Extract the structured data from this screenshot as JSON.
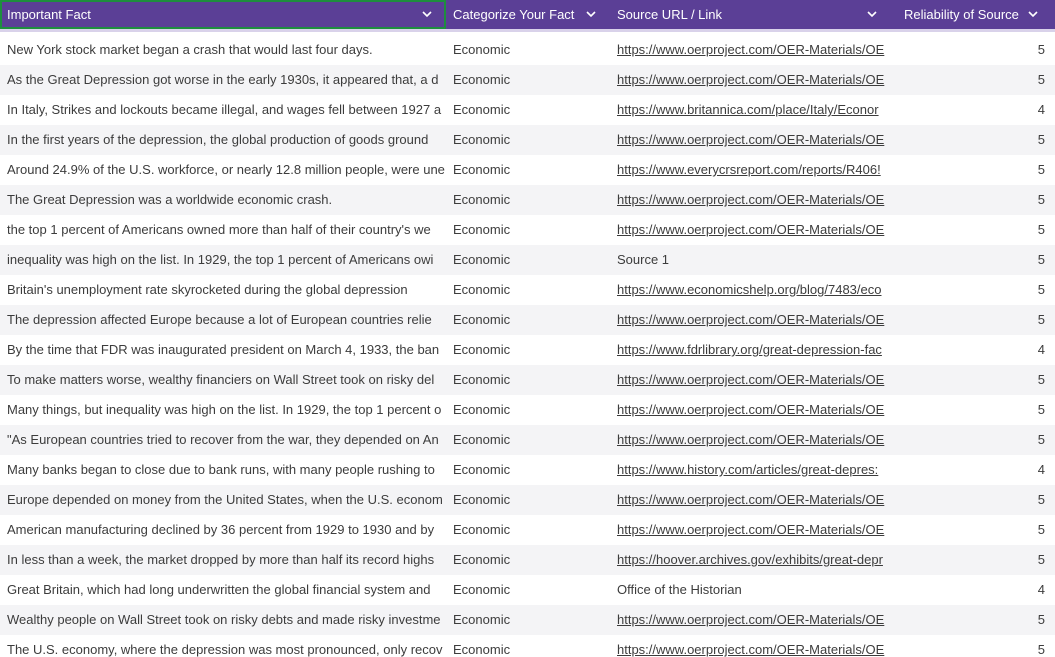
{
  "header": {
    "columns": [
      {
        "label": "Important Fact",
        "icon": "chevron-down-icon"
      },
      {
        "label": "Categorize Your Fact",
        "icon": "chevron-down-icon"
      },
      {
        "label": "Source URL / Link",
        "icon": "chevron-down-icon"
      },
      {
        "label": "Reliability of Source",
        "icon": "chevron-down-icon"
      }
    ]
  },
  "colors": {
    "header_bg": "#5b3f96",
    "active_border": "#1e8e3e"
  },
  "rows": [
    {
      "fact": "New York stock market began a crash that would last four days.",
      "category": "Economic",
      "source": "https://www.oerproject.com/OER-Materials/OE",
      "is_link": true,
      "reliability": "5"
    },
    {
      "fact": "As the Great Depression got worse in the early 1930s, it appeared that, a d",
      "category": "Economic",
      "source": "https://www.oerproject.com/OER-Materials/OE",
      "is_link": true,
      "reliability": "5"
    },
    {
      "fact": "In Italy, Strikes and lockouts became illegal, and wages fell between 1927 a",
      "category": "Economic",
      "source": "https://www.britannica.com/place/Italy/Econor",
      "is_link": true,
      "reliability": "4"
    },
    {
      "fact": "In the first years of the depression, the global production of goods ground",
      "category": "Economic",
      "source": "https://www.oerproject.com/OER-Materials/OE",
      "is_link": true,
      "reliability": "5"
    },
    {
      "fact": "Around 24.9% of the U.S. workforce, or nearly 12.8 million people, were une",
      "category": "Economic",
      "source": "https://www.everycrsreport.com/reports/R406!",
      "is_link": true,
      "reliability": "5"
    },
    {
      "fact": "The Great Depression was a worldwide economic crash.",
      "category": "Economic",
      "source": "https://www.oerproject.com/OER-Materials/OE",
      "is_link": true,
      "reliability": "5"
    },
    {
      "fact": " the top 1 percent of Americans owned more than half of their country's we",
      "category": "Economic",
      "source": "https://www.oerproject.com/OER-Materials/OE",
      "is_link": true,
      "reliability": "5"
    },
    {
      "fact": "inequality was high on the list. In 1929, the top 1 percent of Americans owi",
      "category": "Economic",
      "source": "Source 1",
      "is_link": false,
      "reliability": "5"
    },
    {
      "fact": "Britain's unemployment rate skyrocketed during the global depression",
      "category": "Economic",
      "source": "https://www.economicshelp.org/blog/7483/eco",
      "is_link": true,
      "reliability": "5"
    },
    {
      "fact": "The  depression affected Europe because a lot of European countries relie",
      "category": "Economic",
      "source": "https://www.oerproject.com/OER-Materials/OE",
      "is_link": true,
      "reliability": "5"
    },
    {
      "fact": "By the time that FDR was inaugurated president on March 4, 1933, the ban",
      "category": "Economic",
      "source": "https://www.fdrlibrary.org/great-depression-fac",
      "is_link": true,
      "reliability": "4"
    },
    {
      "fact": "To make matters worse, wealthy financiers on Wall Street took on risky del",
      "category": "Economic",
      "source": "https://www.oerproject.com/OER-Materials/OE",
      "is_link": true,
      "reliability": "5"
    },
    {
      "fact": "Many things, but inequality was high on the list. In 1929, the top 1 percent o",
      "category": "Economic",
      "source": "https://www.oerproject.com/OER-Materials/OE",
      "is_link": true,
      "reliability": "5"
    },
    {
      "fact": "\"As European countries tried to recover from the war, they depended on An",
      "category": "Economic",
      "source": "https://www.oerproject.com/OER-Materials/OE",
      "is_link": true,
      "reliability": "5"
    },
    {
      "fact": "Many banks began to close due to bank runs, with many people rushing to",
      "category": "Economic",
      "source": "https://www.history.com/articles/great-depres:",
      "is_link": true,
      "reliability": "4"
    },
    {
      "fact": "Europe depended on money from the United States, when the U.S. econom",
      "category": "Economic",
      "source": "https://www.oerproject.com/OER-Materials/OE",
      "is_link": true,
      "reliability": "5"
    },
    {
      "fact": "American manufacturing declined by 36 percent from 1929 to 1930 and by",
      "category": "Economic",
      "source": "https://www.oerproject.com/OER-Materials/OE",
      "is_link": true,
      "reliability": "5"
    },
    {
      "fact": "In less than a week, the market dropped by more than half its record highs",
      "category": "Economic",
      "source": "https://hoover.archives.gov/exhibits/great-depr",
      "is_link": true,
      "reliability": "5"
    },
    {
      "fact": " Great Britain, which had long underwritten the global financial system and",
      "category": "Economic",
      "source": "Office of the Historian",
      "is_link": false,
      "reliability": "4"
    },
    {
      "fact": "Wealthy people on Wall Street took on risky debts and made risky investme",
      "category": "Economic",
      "source": "https://www.oerproject.com/OER-Materials/OE",
      "is_link": true,
      "reliability": "5"
    },
    {
      "fact": "The U.S. economy, where the depression was most pronounced, only recov",
      "category": "Economic",
      "source": "https://www.oerproject.com/OER-Materials/OE",
      "is_link": true,
      "reliability": "5"
    }
  ]
}
